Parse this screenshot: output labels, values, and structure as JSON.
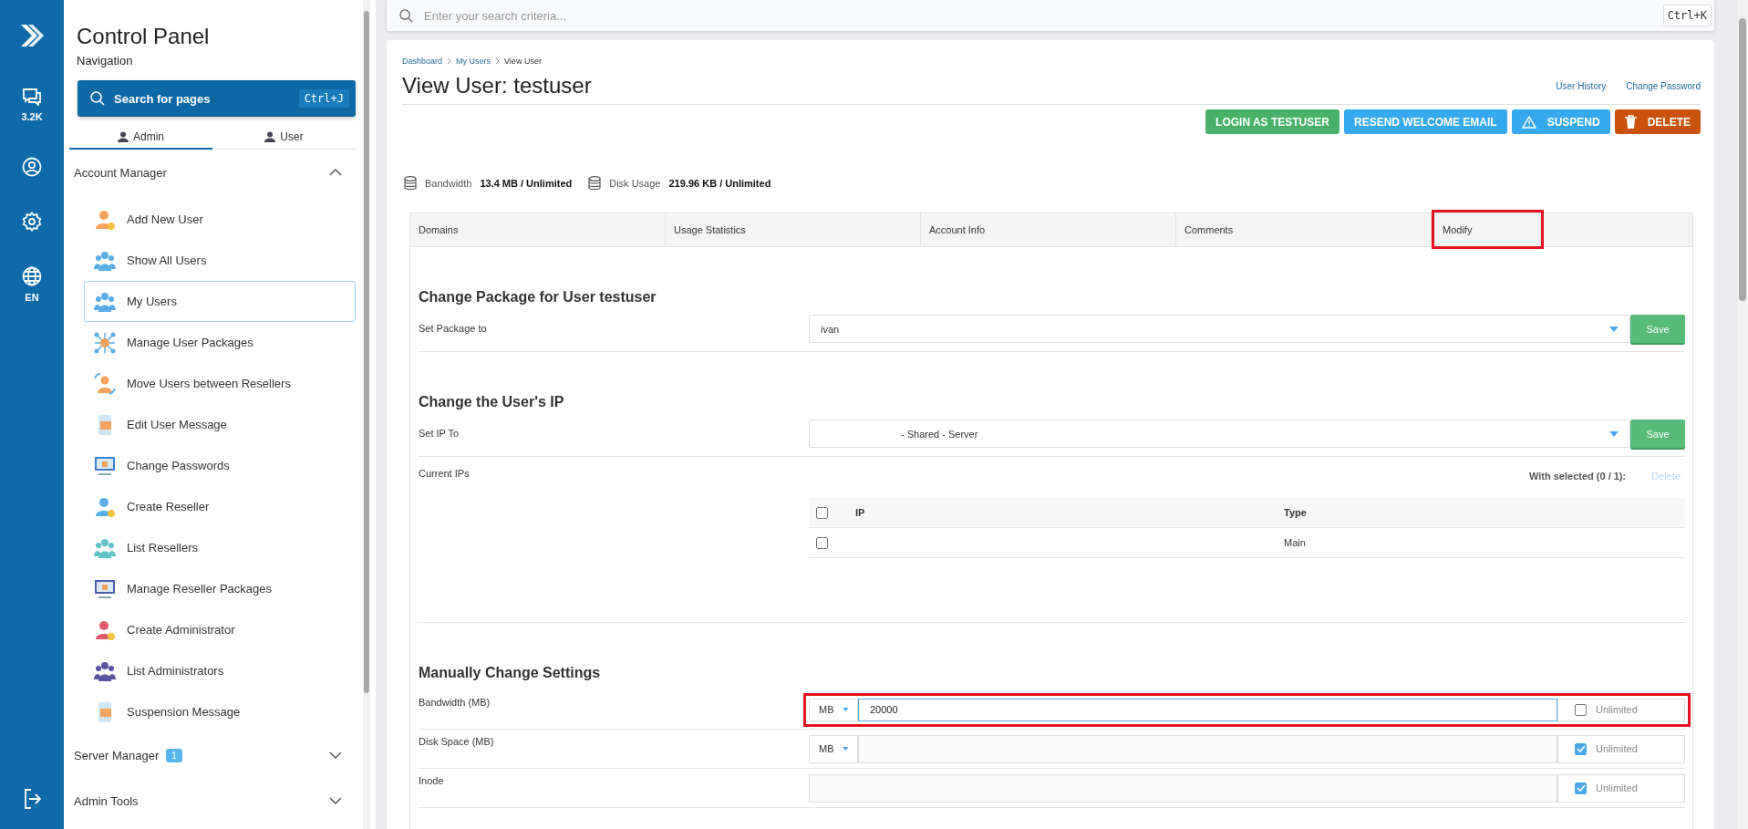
{
  "rail": {
    "items": [
      {
        "kind": "logo"
      },
      {
        "kind": "chat",
        "label": "3.2K"
      },
      {
        "kind": "user"
      },
      {
        "kind": "settings"
      },
      {
        "kind": "globe",
        "label": "EN"
      },
      {
        "kind": "logout"
      }
    ]
  },
  "sidebar": {
    "title": "Control Panel",
    "subtitle": "Navigation",
    "search": {
      "placeholder": "Search for pages",
      "shortcut": "Ctrl+J"
    },
    "tabs": [
      {
        "label": "Admin",
        "selected": true
      },
      {
        "label": "User",
        "selected": false
      }
    ],
    "sections": [
      {
        "label": "Account Manager",
        "expanded": true,
        "items": [
          {
            "label": "Add New User",
            "kind": "person",
            "color": "#f5a25d",
            "selected": false
          },
          {
            "label": "Show All Users",
            "kind": "group",
            "color": "#5aaee8",
            "selected": false
          },
          {
            "label": "My Users",
            "kind": "group",
            "color": "#5aaee8",
            "selected": true
          },
          {
            "label": "Manage User Packages",
            "kind": "network",
            "color": "#5aaee8",
            "selected": false
          },
          {
            "label": "Move Users between Resellers",
            "kind": "move",
            "color": "#f5a25d",
            "selected": false
          },
          {
            "label": "Edit User Message",
            "kind": "phone",
            "color": "#f5a25d",
            "selected": false
          },
          {
            "label": "Change Passwords",
            "kind": "monitor",
            "color": "#3f7fcf",
            "selected": false
          },
          {
            "label": "Create Reseller",
            "kind": "person",
            "color": "#5aaee8",
            "selected": false
          },
          {
            "label": "List Resellers",
            "kind": "group",
            "color": "#5fc0c8",
            "selected": false
          },
          {
            "label": "Manage Reseller Packages",
            "kind": "monitor",
            "color": "#5060b0",
            "selected": false
          },
          {
            "label": "Create Administrator",
            "kind": "person",
            "color": "#e05a6a",
            "selected": false
          },
          {
            "label": "List Administrators",
            "kind": "group",
            "color": "#5a54a0",
            "selected": false
          },
          {
            "label": "Suspension Message",
            "kind": "phone",
            "color": "#f5a25d",
            "selected": false
          }
        ]
      },
      {
        "label": "Server Manager",
        "badge": "1",
        "expanded": false
      },
      {
        "label": "Admin Tools",
        "expanded": false
      }
    ]
  },
  "search": {
    "placeholder": "Enter your search criteria...",
    "shortcut": "Ctrl+K"
  },
  "breadcrumb": [
    "Dashboard",
    "My Users",
    "View User"
  ],
  "title": "View User: testuser",
  "links": [
    "User History",
    "Change Password"
  ],
  "actions": [
    {
      "label": "LOGIN AS TESTUSER",
      "kind": "success"
    },
    {
      "label": "RESEND WELCOME EMAIL",
      "kind": "info"
    },
    {
      "label": "SUSPEND",
      "kind": "warning"
    },
    {
      "label": "DELETE",
      "kind": "danger"
    }
  ],
  "stats": [
    {
      "label": "Bandwidth",
      "value": "13.4 MB / Unlimited"
    },
    {
      "label": "Disk Usage",
      "value": "219.96 KB / Unlimited"
    }
  ],
  "tabs": [
    {
      "label": "Domains",
      "highlighted": false
    },
    {
      "label": "Usage Statistics",
      "highlighted": false
    },
    {
      "label": "Account Info",
      "highlighted": false
    },
    {
      "label": "Comments",
      "highlighted": false
    },
    {
      "label": "Modify",
      "highlighted": true
    }
  ],
  "package_section": {
    "heading": "Change Package for User testuser",
    "label": "Set Package to",
    "value": "ivan",
    "button": "Save"
  },
  "ip_section": {
    "heading": "Change the User's IP",
    "label": "Set IP To",
    "value": "- Shared - Server",
    "button": "Save",
    "current_label": "Current IPs",
    "with_selected": "With selected (0 / 1):",
    "delete": {
      "label": "Delete",
      "disabled": true
    },
    "table": {
      "all_checked": false,
      "columns": [
        "IP",
        "Type"
      ],
      "rows": [
        {
          "type": "Main",
          "checked": false
        }
      ]
    }
  },
  "settings": {
    "heading": "Manually Change Settings",
    "rows": [
      {
        "kind": "unit",
        "label": "Bandwidth (MB)",
        "unit": "MB",
        "value": "20000",
        "unlimited_label": "Unlimited",
        "unlimited": false,
        "highlighted": true
      },
      {
        "kind": "unit",
        "label": "Disk Space (MB)",
        "unit": "MB",
        "unlimited_label": "Unlimited",
        "unlimited": true,
        "highlighted": false
      },
      {
        "kind": "plain",
        "label": "Inode",
        "unlimited_label": "Unlimited",
        "unlimited": true,
        "highlighted": false
      }
    ]
  }
}
